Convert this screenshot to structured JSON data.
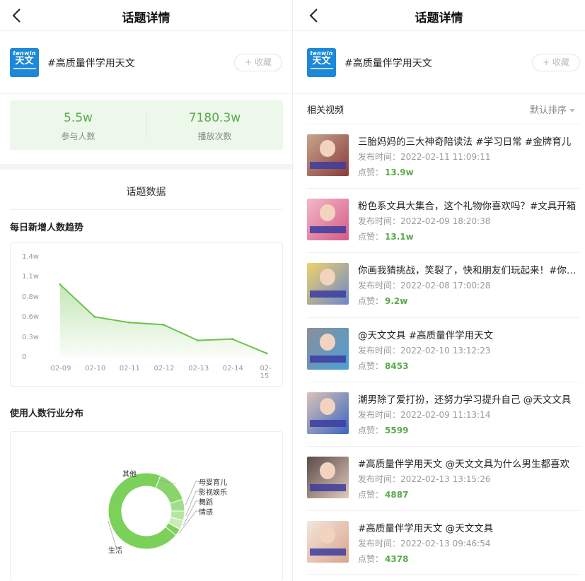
{
  "left": {
    "nav_title": "话题详情",
    "logo_en": "tenwin",
    "logo_cn": "天文",
    "topic": "#高质量伴学用天文",
    "fav_label": "+ 收藏",
    "stats": [
      {
        "value": "5.5w",
        "label": "参与人数"
      },
      {
        "value": "7180.3w",
        "label": "播放次数"
      }
    ],
    "section_title": "话题数据",
    "trend_title": "每日新增人数趋势",
    "industry_title": "使用人数行业分布"
  },
  "chart_data": [
    {
      "type": "area",
      "title": "每日新增人数趋势",
      "categories": [
        "02-09",
        "02-10",
        "02-11",
        "02-12",
        "02-13",
        "02-14",
        "02-15"
      ],
      "values": [
        1.02,
        0.57,
        0.49,
        0.46,
        0.24,
        0.26,
        0.06
      ],
      "unit": "w",
      "yticks": [
        "0",
        "0.3w",
        "0.6w",
        "0.8w",
        "1.1w",
        "1.4w"
      ],
      "ylim": [
        0,
        1.4
      ],
      "color": "#6cc24a"
    },
    {
      "type": "pie",
      "title": "使用人数行业分布",
      "labels": [
        "生活",
        "其他",
        "母婴育儿",
        "影视娱乐",
        "舞蹈",
        "情感"
      ],
      "values": [
        70,
        14,
        5,
        4,
        4,
        3
      ],
      "color": "#7bd15a"
    }
  ],
  "right": {
    "nav_title": "话题详情",
    "logo_en": "tenwin",
    "logo_cn": "天文",
    "topic": "#高质量伴学用天文",
    "fav_label": "+ 收藏",
    "related_title": "相关视频",
    "sort_label": "默认排序",
    "meta_prefix": "发布时间：",
    "likes_prefix": "点赞：",
    "videos": [
      {
        "title": "三胎妈妈的三大神奇陪读法 #学习日常 #金牌育儿",
        "time": "2022-02-11 11:09:11",
        "likes": "13.9w"
      },
      {
        "title": "粉色系文具大集合，这个礼物你喜欢吗？#文具开箱",
        "time": "2022-02-09 18:20:38",
        "likes": "13.1w"
      },
      {
        "title": "你画我猜挑战，笑裂了，快和朋友们玩起来！#你画我猜",
        "time": "2022-02-08 17:00:28",
        "likes": "9.2w"
      },
      {
        "title": "@天文文具 #高质量伴学用天文",
        "time": "2022-02-10 13:12:23",
        "likes": "8453"
      },
      {
        "title": "潮男除了爱打扮，还努力学习提升自己 @天文文具",
        "time": "2022-02-09 11:13:14",
        "likes": "5599"
      },
      {
        "title": "#高质量伴学用天文 @天文文具为什么男生都喜欢",
        "time": "2022-02-13 13:15:26",
        "likes": "4887"
      },
      {
        "title": "#高质量伴学用天文 @天文文具",
        "time": "2022-02-13 09:46:54",
        "likes": "4378"
      }
    ]
  }
}
